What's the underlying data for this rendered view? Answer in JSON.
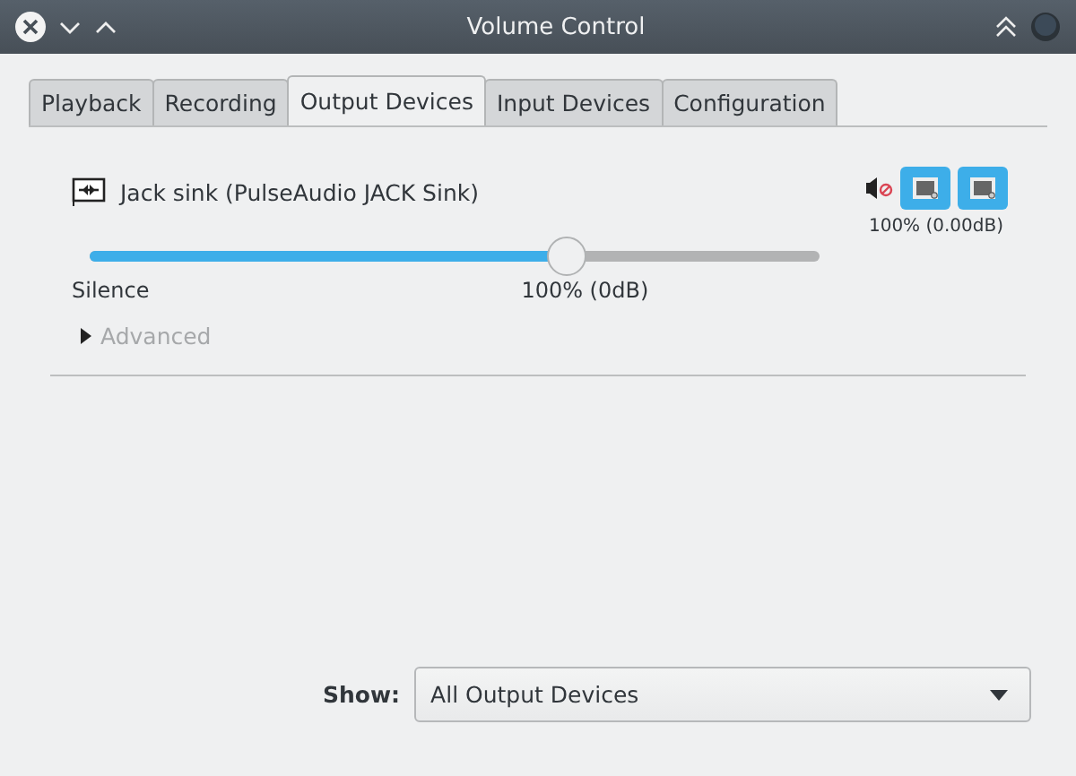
{
  "window": {
    "title": "Volume Control"
  },
  "tabs": [
    {
      "label": "Playback",
      "selected": false
    },
    {
      "label": "Recording",
      "selected": false
    },
    {
      "label": "Output Devices",
      "selected": true
    },
    {
      "label": "Input Devices",
      "selected": false
    },
    {
      "label": "Configuration",
      "selected": false
    }
  ],
  "devices": [
    {
      "name": "Jack sink (PulseAudio JACK Sink)",
      "level": 0.654,
      "min_label": "Silence",
      "reading": "100% (0dB)",
      "peak_reading": "100% (0.00dB)",
      "buttons": [
        {
          "on": true
        },
        {
          "on": true
        }
      ],
      "advanced": {
        "label": "Advanced",
        "expanded": false,
        "disabled": true
      }
    }
  ],
  "show": {
    "label": "Show:",
    "value": "All Output Devices"
  }
}
